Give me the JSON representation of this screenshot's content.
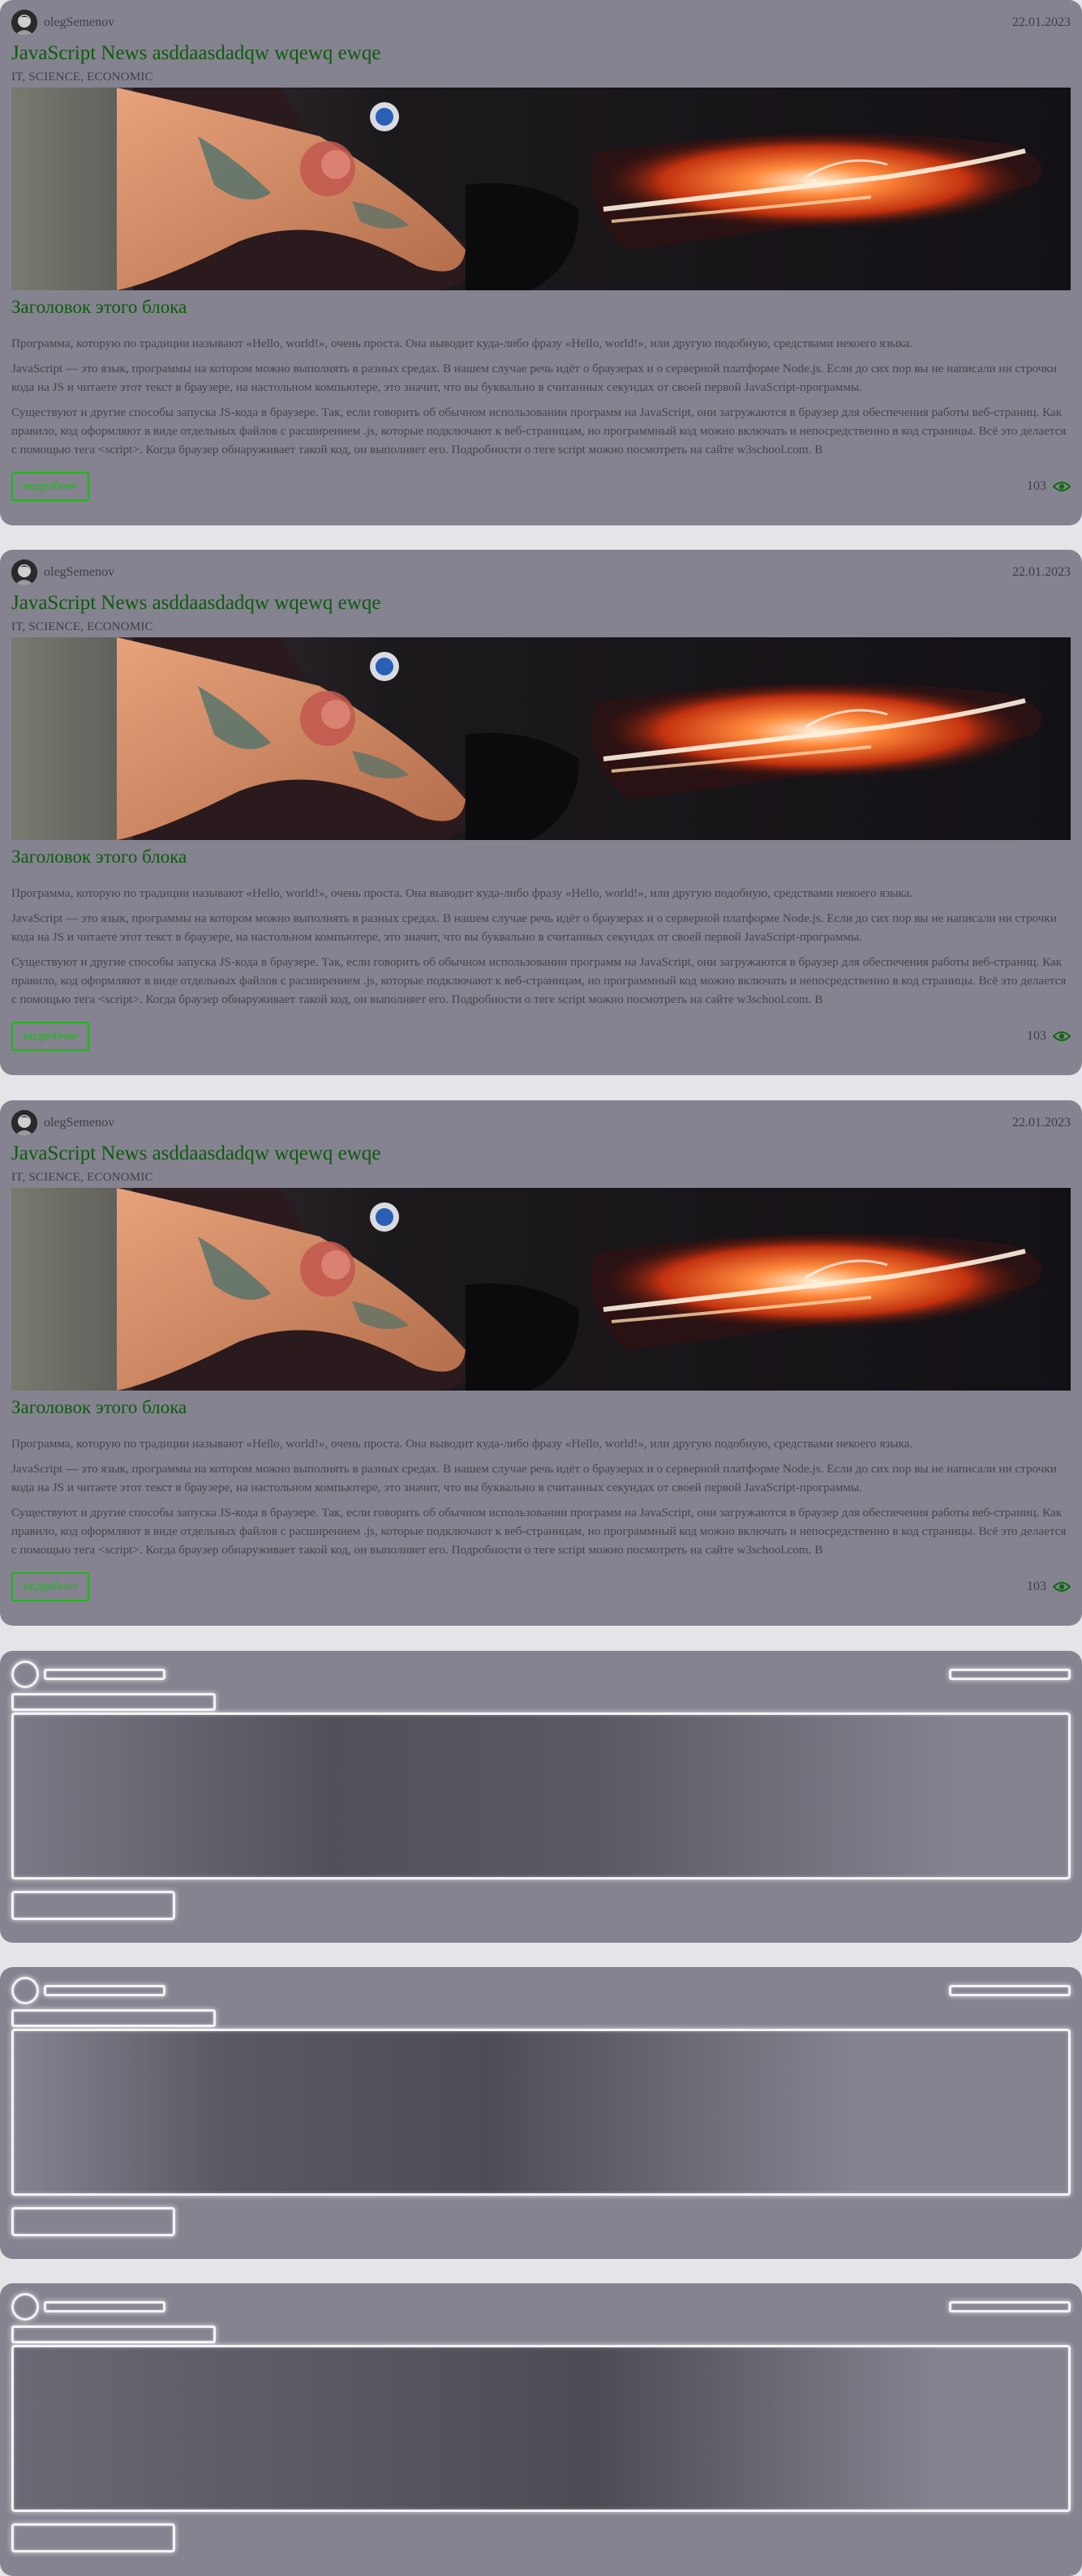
{
  "colors": {
    "page_background": "#e5e4e8",
    "card_background": "#84838f",
    "title_green": "#0f5a0f",
    "button_green": "#22b51e",
    "text_gray": "#3f3e47"
  },
  "posts": [
    {
      "author": "olegSemenov",
      "date": "22.01.2023",
      "title": "JavaScript News asddaasdadqw wqewq ewqe",
      "tags": "IT, SCIENCE, ECONOMIC",
      "block_title": "Заголовок этого блока",
      "paragraphs": [
        "Программа, которую по традиции называют «Hello, world!», очень проста. Она выводит куда-либо фразу «Hello, world!», или другую подобную, средствами некоего языка.",
        "JavaScript — это язык, программы на котором можно выполнять в разных средах. В нашем случае речь идёт о браузерах и о серверной платформе Node.js. Если до сих пор вы не написали ни строчки кода на JS и читаете этот текст в браузере, на настольном компьютере, это значит, что вы буквально в считанных секундах от своей первой JavaScript-программы.",
        "Существуют и другие способы запуска JS-кода в браузере. Так, если говорить об обычном использовании программ на JavaScript, они загружаются в браузер для обеспечения работы веб-страниц. Как правило, код оформляют в виде отдельных файлов с расширением .js, которые подключают к веб-страницам, но программный код можно включать и непосредственно в код страницы. Всё это делается с помощью тега <script>. Когда браузер обнаруживает такой код, он выполняет его. Подробности о теге script можно посмотреть на сайте w3school.com. В"
      ],
      "more_label": "подробнее",
      "views": "103",
      "eye_icon": "eye-icon"
    },
    {
      "author": "olegSemenov",
      "date": "22.01.2023",
      "title": "JavaScript News asddaasdadqw wqewq ewqe",
      "tags": "IT, SCIENCE, ECONOMIC",
      "block_title": "Заголовок этого блока",
      "paragraphs": [
        "Программа, которую по традиции называют «Hello, world!», очень проста. Она выводит куда-либо фразу «Hello, world!», или другую подобную, средствами некоего языка.",
        "JavaScript — это язык, программы на котором можно выполнять в разных средах. В нашем случае речь идёт о браузерах и о серверной платформе Node.js. Если до сих пор вы не написали ни строчки кода на JS и читаете этот текст в браузере, на настольном компьютере, это значит, что вы буквально в считанных секундах от своей первой JavaScript-программы.",
        "Существуют и другие способы запуска JS-кода в браузере. Так, если говорить об обычном использовании программ на JavaScript, они загружаются в браузер для обеспечения работы веб-страниц. Как правило, код оформляют в виде отдельных файлов с расширением .js, которые подключают к веб-страницам, но программный код можно включать и непосредственно в код страницы. Всё это делается с помощью тега <script>. Когда браузер обнаруживает такой код, он выполняет его. Подробности о теге script можно посмотреть на сайте w3school.com. В"
      ],
      "more_label": "подробнее",
      "views": "103",
      "eye_icon": "eye-icon"
    },
    {
      "author": "olegSemenov",
      "date": "22.01.2023",
      "title": "JavaScript News asddaasdadqw wqewq ewqe",
      "tags": "IT, SCIENCE, ECONOMIC",
      "block_title": "Заголовок этого блока",
      "paragraphs": [
        "Программа, которую по традиции называют «Hello, world!», очень проста. Она выводит куда-либо фразу «Hello, world!», или другую подобную, средствами некоего языка.",
        "JavaScript — это язык, программы на котором можно выполнять в разных средах. В нашем случае речь идёт о браузерах и о серверной платформе Node.js. Если до сих пор вы не написали ни строчки кода на JS и читаете этот текст в браузере, на настольном компьютере, это значит, что вы буквально в считанных секундах от своей первой JavaScript-программы.",
        "Существуют и другие способы запуска JS-кода в браузере. Так, если говорить об обычном использовании программ на JavaScript, они загружаются в браузер для обеспечения работы веб-страниц. Как правило, код оформляют в виде отдельных файлов с расширением .js, которые подключают к веб-страницам, но программный код можно включать и непосредственно в код страницы. Всё это делается с помощью тега <script>. Когда браузер обнаруживает такой код, он выполняет его. Подробности о теге script можно посмотреть на сайте w3school.com. В"
      ],
      "more_label": "подробнее",
      "views": "103",
      "eye_icon": "eye-icon"
    }
  ],
  "skeleton_count": 3
}
